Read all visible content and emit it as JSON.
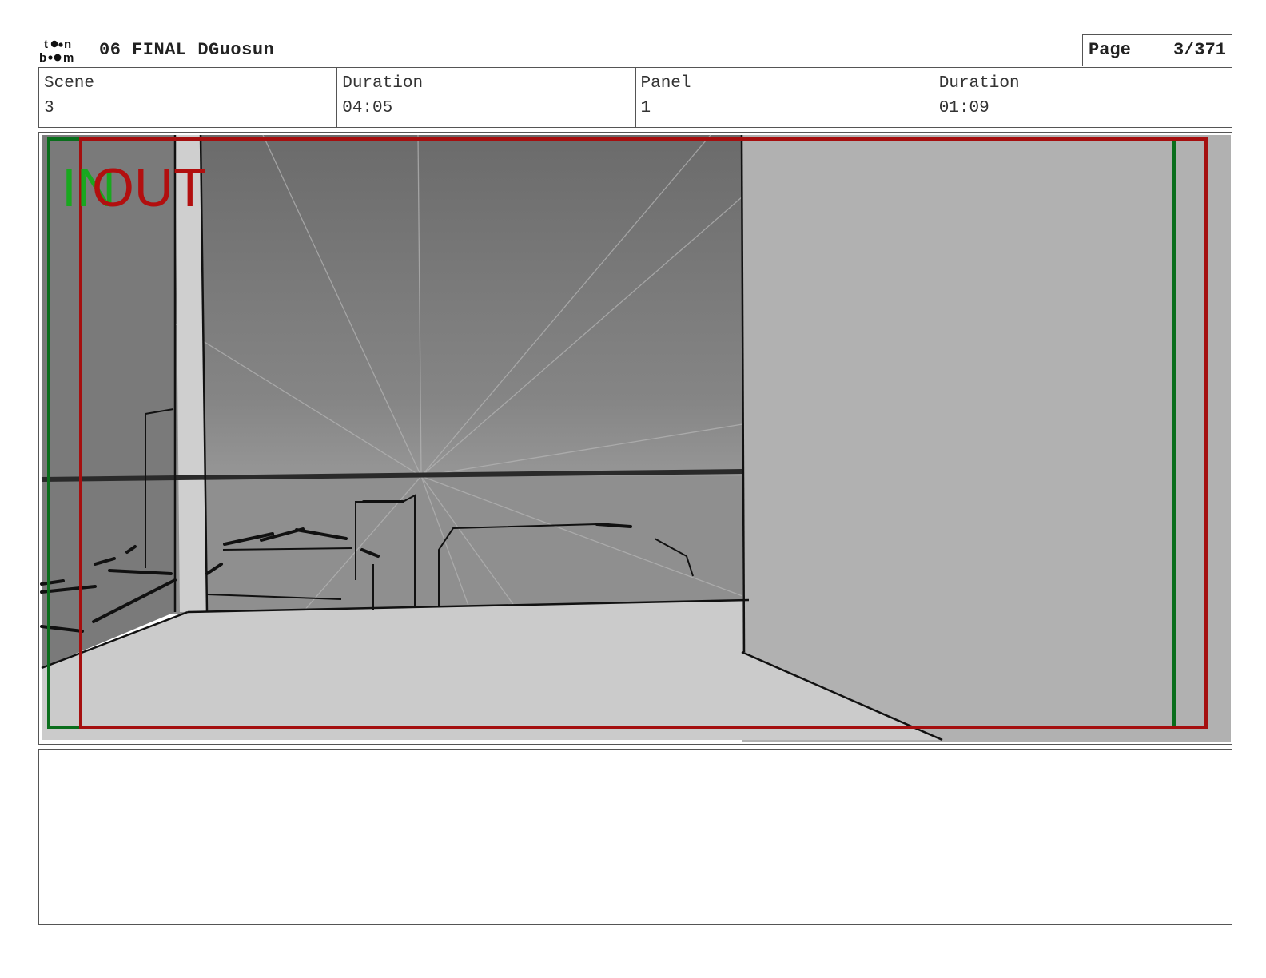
{
  "header": {
    "logo_text": "toon boom",
    "title": "06 FINAL DGuosun",
    "page_label": "Page",
    "page_value": "3/371"
  },
  "info": {
    "scene_label": "Scene",
    "scene_value": "3",
    "scene_duration_label": "Duration",
    "scene_duration_value": "04:05",
    "panel_label": "Panel",
    "panel_value": "1",
    "panel_duration_label": "Duration",
    "panel_duration_value": "01:09"
  },
  "panel": {
    "in_marker": "IN",
    "out_marker": "OUT",
    "colors": {
      "in_frame": "#0a6e1c",
      "out_frame": "#a50f0f",
      "in_text": "#19a81f",
      "out_text": "#b20f0f"
    }
  },
  "notes": {
    "text": ""
  }
}
